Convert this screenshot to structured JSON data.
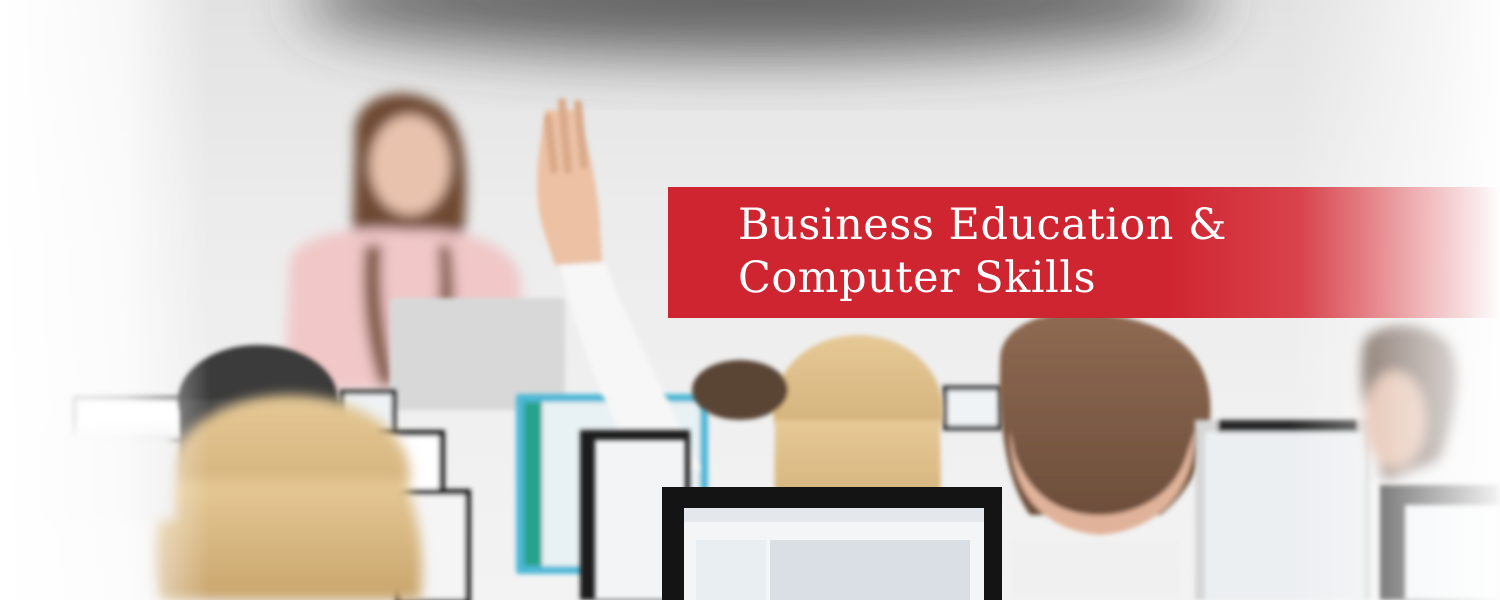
{
  "banner": {
    "line1": "Business Education &",
    "line2": "Computer Skills",
    "color": "#cf2530",
    "text_color": "#ffffff"
  },
  "photo": {
    "subject": "classroom-computer-lab"
  }
}
